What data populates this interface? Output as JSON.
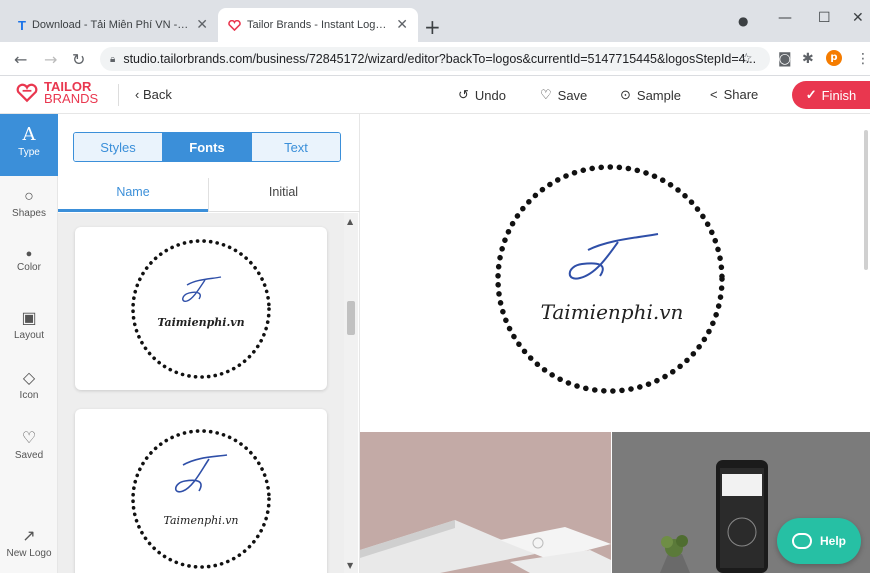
{
  "browser": {
    "tabs": [
      {
        "title": "Download - Tải Miễn Phí VN - Ph",
        "favicon": "T"
      },
      {
        "title": "Tailor Brands - Instant Logo Mak",
        "favicon": "tailor-brands-logo"
      }
    ],
    "new_tab": "+",
    "window": {
      "minimize": "—",
      "maximize": "☐",
      "close": "✕"
    },
    "url": "studio.tailorbrands.com/business/72845172/wizard/editor?backTo=logos&currentId=5147715445&logosStepId=4...",
    "profile_initial": "p"
  },
  "header": {
    "brand_line1": "TAILOR",
    "brand_line2": "BRANDS",
    "back": "‹ Back",
    "undo": "Undo",
    "save": "Save",
    "sample": "Sample",
    "share": "Share",
    "finish": "Finish",
    "accent": "#e9374f"
  },
  "rail": [
    {
      "label": "Type",
      "icon": "A"
    },
    {
      "label": "Shapes",
      "icon": "○"
    },
    {
      "label": "Color",
      "icon": "●"
    },
    {
      "label": "Layout",
      "icon": "▣"
    },
    {
      "label": "Icon",
      "icon": "◇"
    },
    {
      "label": "Saved",
      "icon": "♡"
    },
    {
      "label": "New Logo",
      "icon": "↗"
    }
  ],
  "panel": {
    "segments": [
      "Styles",
      "Fonts",
      "Text"
    ],
    "subtabs": [
      "Name",
      "Initial"
    ],
    "cards": [
      {
        "name": "Taimienphi.vn"
      },
      {
        "name": "Taimenphi.vn"
      }
    ]
  },
  "canvas": {
    "logo_name": "Taimienphi.vn"
  },
  "help": "Help"
}
